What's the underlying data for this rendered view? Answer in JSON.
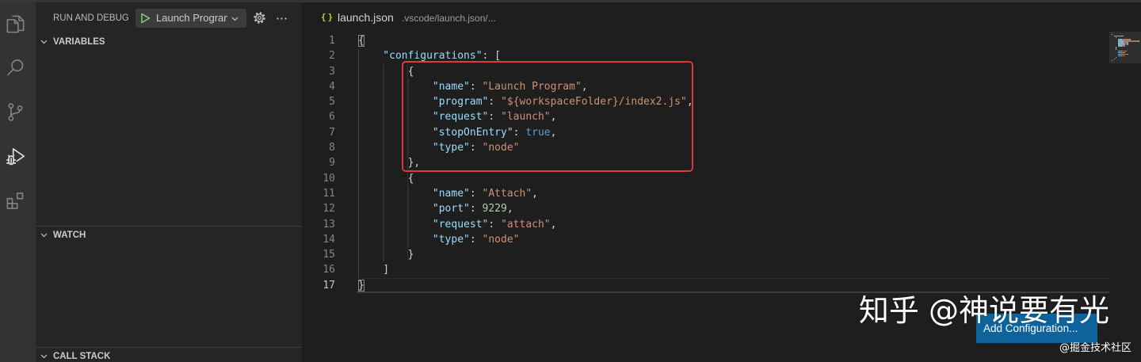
{
  "activity_bar": {
    "icons": [
      "files-icon",
      "search-icon",
      "source-control-icon",
      "run-debug-icon",
      "extensions-icon"
    ],
    "active": "run-debug-icon"
  },
  "sidebar": {
    "title": "RUN AND DEBUG",
    "configuration": "Launch Program",
    "icons": [
      "play-icon",
      "chevron-down-icon",
      "gear-icon",
      "ellipsis-icon"
    ],
    "sections": [
      {
        "label": "VARIABLES",
        "expanded": true
      },
      {
        "label": "WATCH",
        "expanded": true
      },
      {
        "label": "CALL STACK",
        "expanded": true
      }
    ]
  },
  "editor": {
    "file_icon": "{}",
    "file_name": "launch.json",
    "file_path": ".vscode/launch.json/...",
    "active_line": 17,
    "bracket_match_lines": [
      1,
      17
    ],
    "lines": [
      {
        "n": 1,
        "indent": 0,
        "tokens": [
          [
            "p",
            "{"
          ]
        ]
      },
      {
        "n": 2,
        "indent": 1,
        "tokens": [
          [
            "k",
            "\"configurations\""
          ],
          [
            "p",
            ": ["
          ]
        ]
      },
      {
        "n": 3,
        "indent": 2,
        "tokens": [
          [
            "p",
            "{"
          ]
        ]
      },
      {
        "n": 4,
        "indent": 3,
        "tokens": [
          [
            "k",
            "\"name\""
          ],
          [
            "p",
            ": "
          ],
          [
            "s",
            "\"Launch Program\""
          ],
          [
            "p",
            ","
          ]
        ]
      },
      {
        "n": 5,
        "indent": 3,
        "tokens": [
          [
            "k",
            "\"program\""
          ],
          [
            "p",
            ": "
          ],
          [
            "s",
            "\"${workspaceFolder}/index2.js\""
          ],
          [
            "p",
            ","
          ]
        ]
      },
      {
        "n": 6,
        "indent": 3,
        "tokens": [
          [
            "k",
            "\"request\""
          ],
          [
            "p",
            ": "
          ],
          [
            "s",
            "\"launch\""
          ],
          [
            "p",
            ","
          ]
        ]
      },
      {
        "n": 7,
        "indent": 3,
        "tokens": [
          [
            "k",
            "\"stopOnEntry\""
          ],
          [
            "p",
            ": "
          ],
          [
            "b",
            "true"
          ],
          [
            "p",
            ","
          ]
        ]
      },
      {
        "n": 8,
        "indent": 3,
        "tokens": [
          [
            "k",
            "\"type\""
          ],
          [
            "p",
            ": "
          ],
          [
            "s",
            "\"node\""
          ]
        ]
      },
      {
        "n": 9,
        "indent": 2,
        "tokens": [
          [
            "p",
            "},"
          ]
        ]
      },
      {
        "n": 10,
        "indent": 2,
        "tokens": [
          [
            "p",
            "{"
          ]
        ]
      },
      {
        "n": 11,
        "indent": 3,
        "tokens": [
          [
            "k",
            "\"name\""
          ],
          [
            "p",
            ": "
          ],
          [
            "s",
            "\"Attach\""
          ],
          [
            "p",
            ","
          ]
        ]
      },
      {
        "n": 12,
        "indent": 3,
        "tokens": [
          [
            "k",
            "\"port\""
          ],
          [
            "p",
            ": "
          ],
          [
            "n",
            "9229"
          ],
          [
            "p",
            ","
          ]
        ]
      },
      {
        "n": 13,
        "indent": 3,
        "tokens": [
          [
            "k",
            "\"request\""
          ],
          [
            "p",
            ": "
          ],
          [
            "s",
            "\"attach\""
          ],
          [
            "p",
            ","
          ]
        ]
      },
      {
        "n": 14,
        "indent": 3,
        "tokens": [
          [
            "k",
            "\"type\""
          ],
          [
            "p",
            ": "
          ],
          [
            "s",
            "\"node\""
          ]
        ]
      },
      {
        "n": 15,
        "indent": 2,
        "tokens": [
          [
            "p",
            "}"
          ]
        ]
      },
      {
        "n": 16,
        "indent": 1,
        "tokens": [
          [
            "p",
            "]"
          ]
        ]
      },
      {
        "n": 17,
        "indent": 0,
        "tokens": [
          [
            "p",
            "}"
          ]
        ]
      }
    ]
  },
  "annotation": {
    "from_line": 3,
    "to_line": 9
  },
  "add_configuration": "Add Configuration...",
  "watermark": {
    "primary": "知乎 @神说要有光",
    "secondary": "@掘金技术社区"
  },
  "colors": {
    "json_key": "#9cdcfe",
    "json_string": "#ce9178",
    "json_punctuation": "#d4d4d4",
    "json_boolean": "#569cd6",
    "json_number": "#b5cea8",
    "start_debug_green": "#89d185",
    "json_file_icon": "#cbcb41",
    "annotation_red": "#e0383e",
    "button_blue": "#0e639c"
  }
}
